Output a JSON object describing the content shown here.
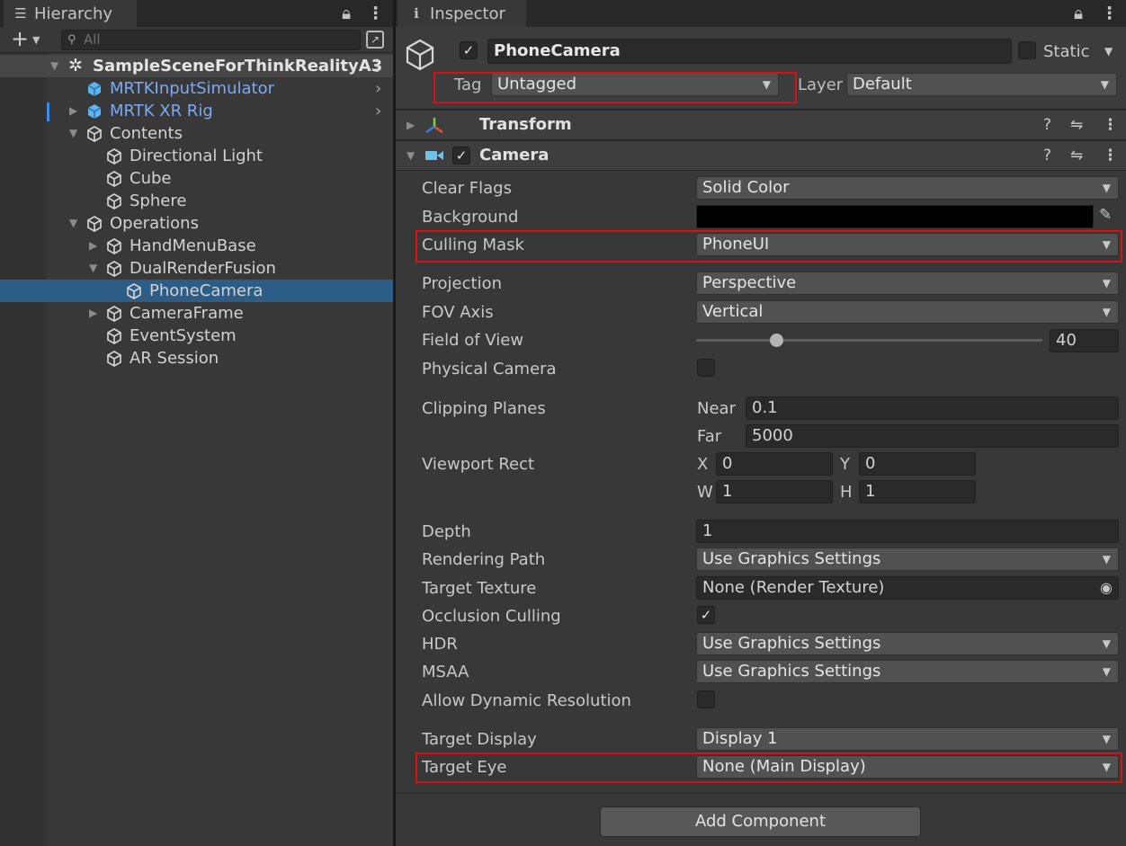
{
  "hierarchy": {
    "tab_label": "Hierarchy",
    "search_placeholder": "All",
    "scene_name": "SampleSceneForThinkRealityA3",
    "items": [
      {
        "label": "MRTKInputSimulator",
        "blue": true,
        "has_arrow": false,
        "expanded": false,
        "depth": 1,
        "prefab_icon": true,
        "nav_arrow": true
      },
      {
        "label": "MRTK XR Rig",
        "blue": true,
        "has_arrow": true,
        "expanded": false,
        "depth": 1,
        "prefab_icon": true,
        "nav_arrow": true
      },
      {
        "label": "Contents",
        "blue": false,
        "has_arrow": true,
        "expanded": true,
        "depth": 1
      },
      {
        "label": "Directional Light",
        "blue": false,
        "has_arrow": false,
        "depth": 2
      },
      {
        "label": "Cube",
        "blue": false,
        "has_arrow": false,
        "depth": 2
      },
      {
        "label": "Sphere",
        "blue": false,
        "has_arrow": false,
        "depth": 2
      },
      {
        "label": "Operations",
        "blue": false,
        "has_arrow": true,
        "expanded": true,
        "depth": 1
      },
      {
        "label": "HandMenuBase",
        "blue": false,
        "has_arrow": true,
        "expanded": false,
        "depth": 2
      },
      {
        "label": "DualRenderFusion",
        "blue": false,
        "has_arrow": true,
        "expanded": true,
        "depth": 2
      },
      {
        "label": "PhoneCamera",
        "blue": false,
        "has_arrow": false,
        "depth": 3,
        "selected": true
      },
      {
        "label": "CameraFrame",
        "blue": false,
        "has_arrow": true,
        "expanded": false,
        "depth": 2
      },
      {
        "label": "EventSystem",
        "blue": false,
        "has_arrow": false,
        "depth": 2
      },
      {
        "label": "AR Session",
        "blue": false,
        "has_arrow": false,
        "depth": 2
      }
    ]
  },
  "inspector": {
    "tab_label": "Inspector",
    "object_name": "PhoneCamera",
    "active": true,
    "static_label": "Static",
    "tag_label": "Tag",
    "tag_value": "Untagged",
    "layer_label": "Layer",
    "layer_value": "Default",
    "transform_title": "Transform",
    "camera_title": "Camera",
    "props": {
      "clear_flags": {
        "label": "Clear Flags",
        "value": "Solid Color"
      },
      "background": {
        "label": "Background",
        "color": "#000000"
      },
      "culling_mask": {
        "label": "Culling Mask",
        "value": "PhoneUI"
      },
      "projection": {
        "label": "Projection",
        "value": "Perspective"
      },
      "fov_axis": {
        "label": "FOV Axis",
        "value": "Vertical"
      },
      "field_of_view": {
        "label": "Field of View",
        "value": "40",
        "slider_fraction": 0.23
      },
      "physical_camera": {
        "label": "Physical Camera",
        "checked": false
      },
      "clipping_planes": {
        "label": "Clipping Planes",
        "near_label": "Near",
        "near": "0.1",
        "far_label": "Far",
        "far": "5000"
      },
      "viewport_rect": {
        "label": "Viewport Rect",
        "x_label": "X",
        "x": "0",
        "y_label": "Y",
        "y": "0",
        "w_label": "W",
        "w": "1",
        "h_label": "H",
        "h": "1"
      },
      "depth": {
        "label": "Depth",
        "value": "1"
      },
      "rendering_path": {
        "label": "Rendering Path",
        "value": "Use Graphics Settings"
      },
      "target_texture": {
        "label": "Target Texture",
        "value": "None (Render Texture)"
      },
      "occlusion_culling": {
        "label": "Occlusion Culling",
        "checked": true
      },
      "hdr": {
        "label": "HDR",
        "value": "Use Graphics Settings"
      },
      "msaa": {
        "label": "MSAA",
        "value": "Use Graphics Settings"
      },
      "dynamic_resolution": {
        "label": "Allow Dynamic Resolution",
        "checked": false
      },
      "target_display": {
        "label": "Target Display",
        "value": "Display 1"
      },
      "target_eye": {
        "label": "Target Eye",
        "value": "None (Main Display)"
      }
    },
    "add_component": "Add Component"
  },
  "colors": {
    "selection": "#2c5d87",
    "prefab_blue": "#7fa9f0",
    "highlight": "#d21414",
    "panel": "#383838"
  }
}
